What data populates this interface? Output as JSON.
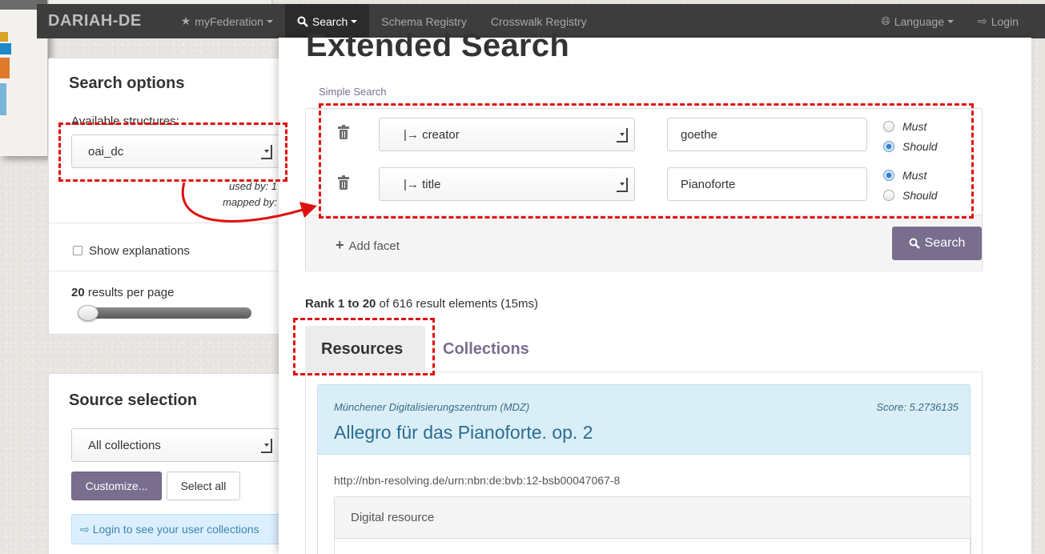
{
  "navbar": {
    "brand": "DARIAH-DE",
    "my_federation": "myFederation",
    "search": "Search",
    "schema_registry": "Schema Registry",
    "crosswalk_registry": "Crosswalk Registry",
    "language": "Language",
    "login": "Login"
  },
  "search_options": {
    "title": "Search options",
    "available_label": "Available structures:",
    "structure_value": "oai_dc",
    "used_by": "used by: 1",
    "mapped_by": "mapped by:",
    "show_explanations": "Show explanations",
    "results_count": "20",
    "results_per_page": " results per page",
    "slider_fraction": 0.0
  },
  "source_selection": {
    "title": "Source selection",
    "collection_value": "All collections",
    "customize_label": "Customize...",
    "select_all_label": "Select all",
    "login_info": "Login to see your user collections"
  },
  "main": {
    "title": "Extended Search",
    "simple_search": "Simple Search",
    "facets": [
      {
        "field": "|→ creator",
        "value": "goethe",
        "must": "Must",
        "should": "Should",
        "selected": "should"
      },
      {
        "field": "|→ title",
        "value": "Pianoforte",
        "must": "Must",
        "should": "Should",
        "selected": "must"
      }
    ],
    "add_facet": "Add facet",
    "search_button": "Search",
    "rank_prefix": "Rank ",
    "rank_range": "1 to 20",
    "rank_suffix": " of 616 result elements (15ms)",
    "tabs": {
      "resources": "Resources",
      "collections": "Collections"
    },
    "result": {
      "provider": "Münchener Digitalisierungszentrum (MDZ)",
      "score": "Score: 5.2736135",
      "title": "Allegro für das Pianoforte. op. 2",
      "url": "http://nbn-resolving.de/urn:nbn:de:bvb:12-bsb00047067-8",
      "digital_resource": "Digital resource"
    }
  },
  "colors": {
    "accent_purple": "#7a6e8f",
    "annotation_red": "#e01010",
    "navbar": "#3d3d3d",
    "result_header": "#daeef7"
  }
}
